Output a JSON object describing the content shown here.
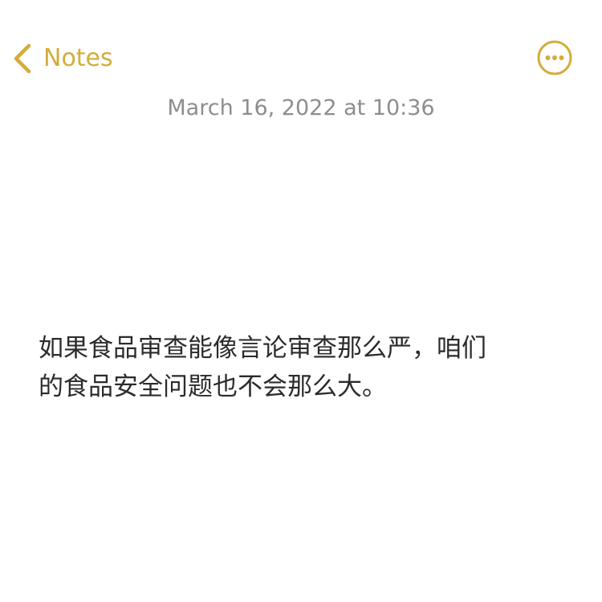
{
  "app": {
    "accent_color": "#d4ac3a",
    "text_color": "#2b2b2b",
    "timestamp_color": "#8d8d8f"
  },
  "nav": {
    "back_icon": "chevron-left-icon",
    "back_label": "Notes",
    "more_icon": "ellipsis-circle-icon"
  },
  "note": {
    "timestamp": "March 16, 2022 at 10:36",
    "lines": [
      "如果食品审查能像言论审查那么严，咱们",
      "的食品安全问题也不会那么大。"
    ]
  }
}
